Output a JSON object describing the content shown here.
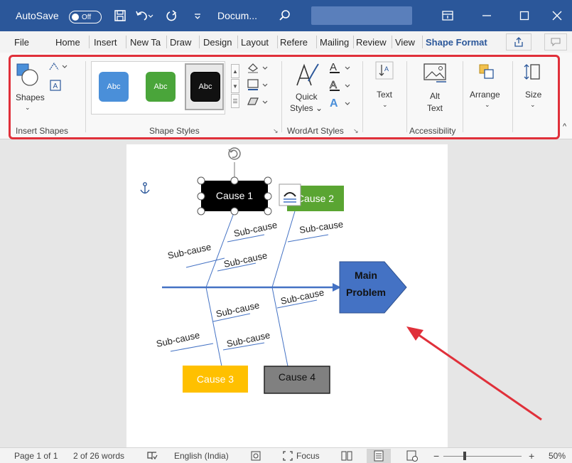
{
  "titlebar": {
    "autosave_label": "AutoSave",
    "autosave_state": "Off",
    "doc_title": "Docum...",
    "icons": [
      "save-icon",
      "undo-icon",
      "redo-icon",
      "customize-icon",
      "search-icon",
      "ribbon-display-icon",
      "minimize-icon",
      "maximize-icon",
      "close-icon"
    ],
    "accent": "#2b579a"
  },
  "menu": {
    "tabs": [
      "File",
      "Home",
      "Insert",
      "New Ta",
      "Draw",
      "Design",
      "Layout",
      "Refere",
      "Mailing",
      "Review",
      "View",
      "Shape Format"
    ],
    "active_tab": "Shape Format"
  },
  "ribbon": {
    "shapes_label": "Shapes",
    "insert_shapes_label": "Insert Shapes",
    "style_swatches": [
      {
        "label": "Abc",
        "color": "#4a8fd9"
      },
      {
        "label": "Abc",
        "color": "#4aa53a"
      },
      {
        "label": "Abc",
        "color": "#111111"
      }
    ],
    "shape_styles_label": "Shape Styles",
    "quick_styles_label": "Quick",
    "quick_styles_label2": "Styles",
    "wordart_styles_label": "WordArt Styles",
    "text_label": "Text",
    "alt_text_label": "Alt",
    "alt_text_label2": "Text",
    "accessibility_label": "Accessibility",
    "arrange_label": "Arrange",
    "size_label": "Size",
    "highlight_color": "#e0303a"
  },
  "diagram": {
    "cause1": "Cause 1",
    "cause2": "Cause 2",
    "cause3": "Cause 3",
    "cause4": "Cause 4",
    "subcause": "Sub-cause",
    "problem_line1": "Main",
    "problem_line2": "Problem",
    "colors": {
      "cause1": "#000000",
      "cause2": "#5aa532",
      "cause3": "#ffc000",
      "cause4": "#808080",
      "problem": "#4472c4",
      "spine": "#4472c4",
      "arrow": "#e0303a"
    }
  },
  "status": {
    "page": "Page 1 of 1",
    "words": "2 of 26 words",
    "language": "English (India)",
    "focus": "Focus",
    "zoom_minus": "−",
    "zoom_plus": "+",
    "zoom": "50%"
  }
}
